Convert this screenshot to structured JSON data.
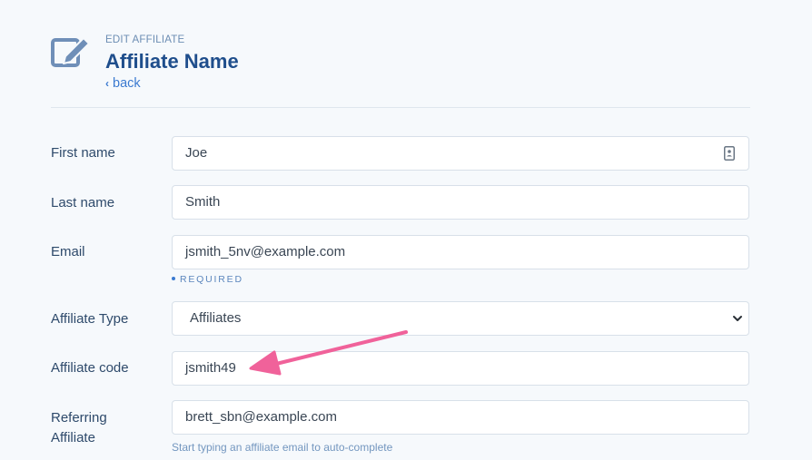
{
  "header": {
    "eyebrow": "EDIT AFFILIATE",
    "title": "Affiliate Name",
    "back_label": "back",
    "icon": "edit-icon"
  },
  "form": {
    "first_name": {
      "label": "First name",
      "value": "Joe",
      "icon": "contact-card-icon"
    },
    "last_name": {
      "label": "Last name",
      "value": "Smith"
    },
    "email": {
      "label": "Email",
      "value": "jsmith_5nv@example.com",
      "note": "REQUIRED"
    },
    "affiliate_type": {
      "label": "Affiliate Type",
      "selected": "Affiliates"
    },
    "affiliate_code": {
      "label": "Affiliate code",
      "value": "jsmith49"
    },
    "referring_affiliate": {
      "label_line1": "Referring",
      "label_line2": "Affiliate",
      "value": "brett_sbn@example.com",
      "hint": "Start typing an affiliate email to auto-complete"
    }
  },
  "colors": {
    "accent": "#3b7ad0",
    "title": "#1f4e8c",
    "annotation_arrow": "#f0629a",
    "background": "#f6f9fc"
  }
}
